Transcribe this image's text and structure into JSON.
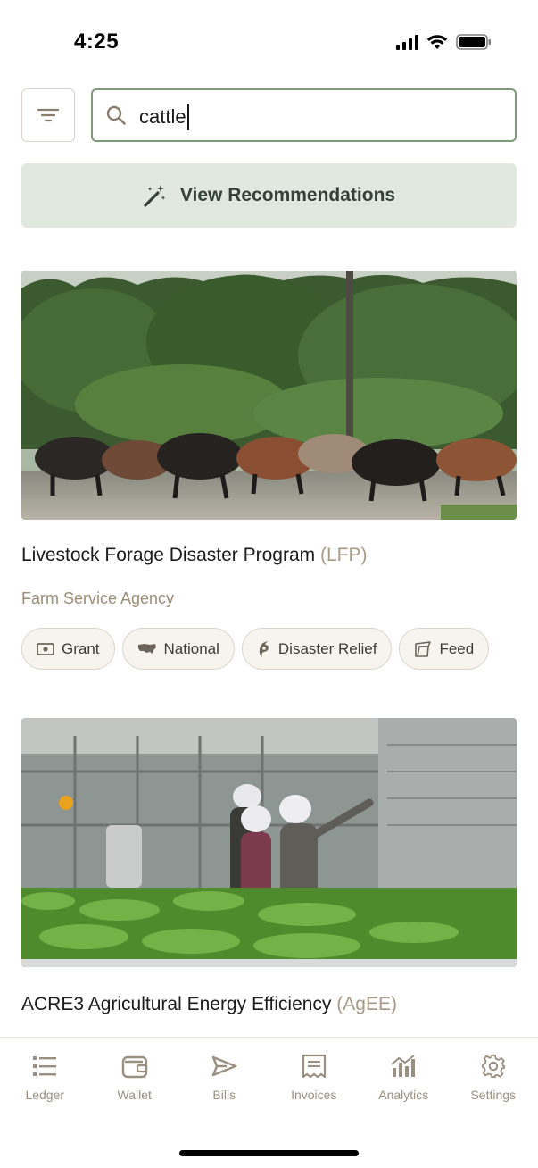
{
  "status_bar": {
    "time": "4:25"
  },
  "search": {
    "value": "cattle",
    "filter_icon": "filter-icon",
    "search_icon": "search-icon"
  },
  "recommendations": {
    "label": "View Recommendations",
    "icon": "magic-wand-icon"
  },
  "cards": [
    {
      "image_desc_icon": "cattle-photo",
      "title": "Livestock Forage Disaster Program",
      "acronym": "(LFP)",
      "agency": "Farm Service Agency",
      "tags": [
        {
          "icon": "money-icon",
          "label": "Grant"
        },
        {
          "icon": "us-map-icon",
          "label": "National"
        },
        {
          "icon": "hurricane-icon",
          "label": "Disaster Relief"
        },
        {
          "icon": "feed-icon",
          "label": "Feed"
        }
      ]
    },
    {
      "image_desc_icon": "greenhouse-photo",
      "title": "ACRE3 Agricultural Energy Efficiency",
      "acronym": "(AgEE)"
    }
  ],
  "tab_bar": {
    "items": [
      {
        "label": "Ledger",
        "icon": "ledger-icon"
      },
      {
        "label": "Wallet",
        "icon": "wallet-icon"
      },
      {
        "label": "Bills",
        "icon": "send-icon"
      },
      {
        "label": "Invoices",
        "icon": "invoice-icon"
      },
      {
        "label": "Analytics",
        "icon": "analytics-icon"
      },
      {
        "label": "Settings",
        "icon": "gear-icon"
      }
    ]
  },
  "colors": {
    "accent_border": "#7d9a79",
    "reco_bg": "#e1e8df",
    "tag_bg": "#f7f4ef",
    "muted_text": "#9c8d78"
  }
}
